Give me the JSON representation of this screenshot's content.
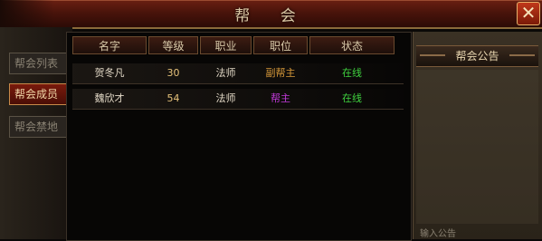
{
  "window": {
    "title": "帮 会",
    "close_label": "✕"
  },
  "side_tabs": [
    {
      "label": "帮会列表",
      "active": false
    },
    {
      "label": "帮会成员",
      "active": true
    },
    {
      "label": "帮会禁地",
      "active": false
    }
  ],
  "table": {
    "headers": [
      "名字",
      "等级",
      "职业",
      "职位",
      "状态"
    ],
    "rows": [
      {
        "name": "贺冬凡",
        "level": "30",
        "job": "法师",
        "position": "副帮主",
        "position_color": "#d89a3a",
        "status": "在线",
        "status_color": "#3fd23f"
      },
      {
        "name": "魏欣才",
        "level": "54",
        "job": "法师",
        "position": "帮主",
        "position_color": "#c03ad8",
        "status": "在线",
        "status_color": "#3fd23f"
      }
    ]
  },
  "notice": {
    "title": "帮会公告",
    "input_placeholder": "输入公告"
  }
}
